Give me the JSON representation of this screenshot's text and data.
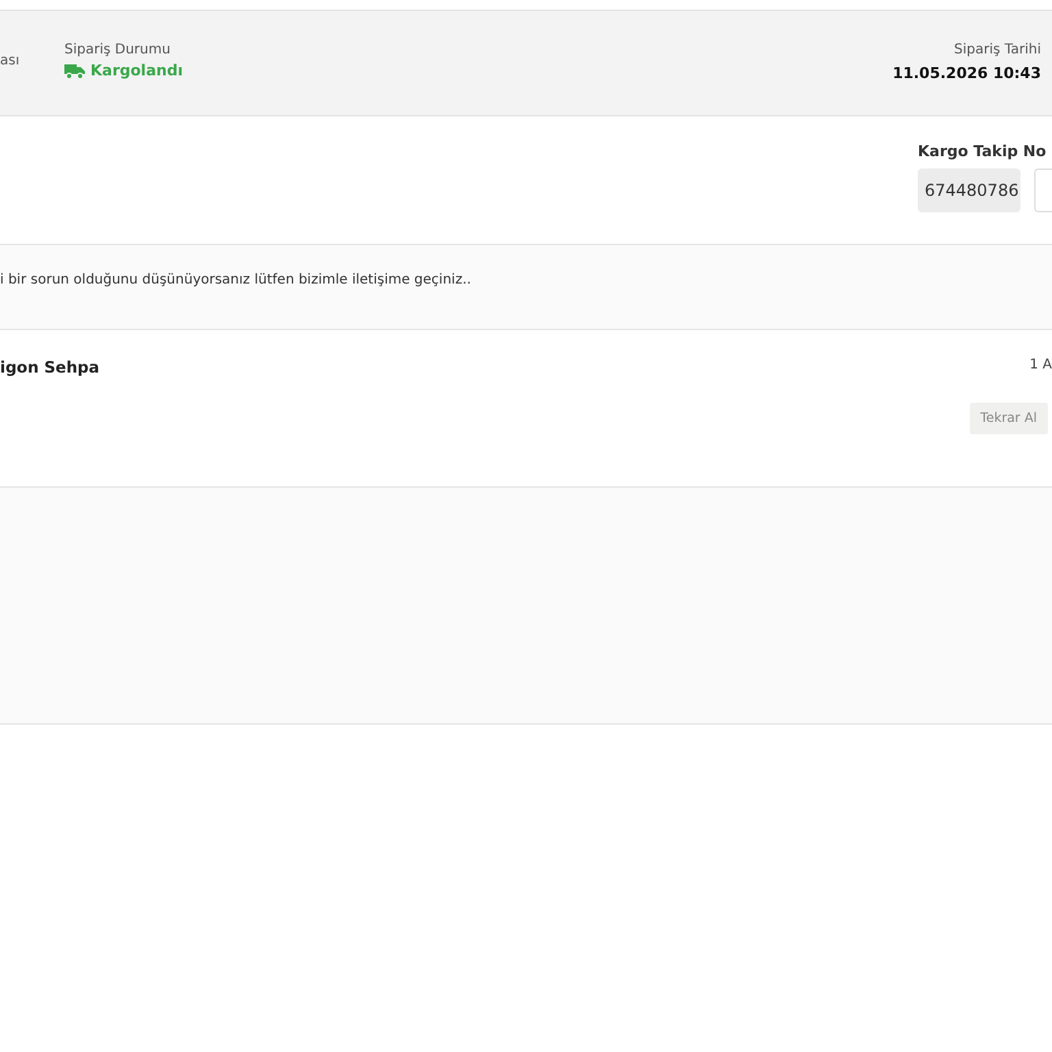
{
  "header": {
    "column_1_label": "ası",
    "status_label": "Sipariş Durumu",
    "status": "Kargolandı",
    "date_label": "Sipariş Tarihi",
    "date": "11.05.2026 10:43"
  },
  "tracking": {
    "label": "Kargo Takip No",
    "number": "674480786"
  },
  "notice": "i bir sorun olduğunu düşünüyorsanız lütfen bizimle iletişime geçiniz..",
  "product": {
    "name": "igon Sehpa",
    "quantity": "1 A",
    "button": "Tekrar Al"
  }
}
